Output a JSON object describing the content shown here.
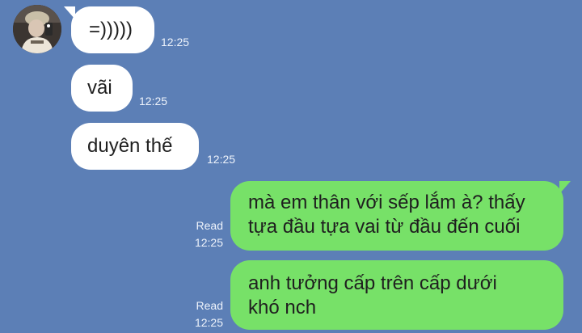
{
  "colors": {
    "background": "#5c7fb6",
    "incoming_bubble": "#ffffff",
    "outgoing_bubble": "#77e168",
    "meta_text": "#eef3fb"
  },
  "messages": [
    {
      "direction": "incoming",
      "text": "=)))))",
      "time": "12:25"
    },
    {
      "direction": "incoming",
      "text": "vãi",
      "time": "12:25"
    },
    {
      "direction": "incoming",
      "text": "duyên thế",
      "time": "12:25"
    },
    {
      "direction": "outgoing",
      "lines": [
        "mà em thân với sếp lắm à? thấy",
        "tựa đầu tựa vai từ đầu đến cuối"
      ],
      "status": "Read",
      "time": "12:25"
    },
    {
      "direction": "outgoing",
      "lines": [
        "anh tưởng cấp trên cấp dưới",
        "khó nch"
      ],
      "status": "Read",
      "time": "12:25"
    }
  ]
}
